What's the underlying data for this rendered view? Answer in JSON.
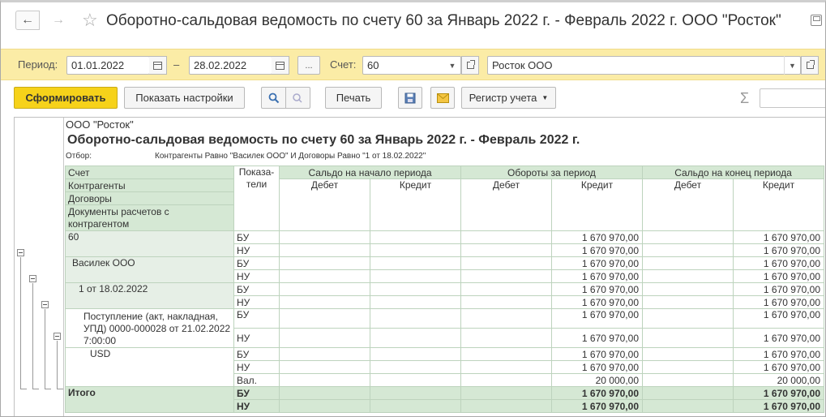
{
  "window": {
    "title": "Оборотно-сальдовая ведомость по счету 60 за Январь 2022 г. - Февраль 2022 г. ООО \"Росток\""
  },
  "filters": {
    "period_label": "Период:",
    "date_from": "01.01.2022",
    "dash": "–",
    "date_to": "28.02.2022",
    "more_label": "...",
    "account_label": "Счет:",
    "account_value": "60",
    "organization_value": "Росток ООО"
  },
  "toolbar": {
    "generate_label": "Сформировать",
    "settings_label": "Показать настройки",
    "print_label": "Печать",
    "register_label": "Регистр учета",
    "sigma": "Σ"
  },
  "report": {
    "org": "ООО \"Росток\"",
    "title": "Оборотно-сальдовая ведомость по счету 60 за Январь 2022 г. - Февраль 2022 г.",
    "filter_label": "Отбор:",
    "filter_text": "Контрагенты Равно \"Василек ООО\" И Договоры Равно \"1 от 18.02.2022\"",
    "headers": {
      "account": "Счет",
      "counterparties": "Контрагенты",
      "contracts": "Договоры",
      "documents": "Документы расчетов с контрагентом",
      "indicators": "Показа-тели",
      "opening": "Сальдо на начало периода",
      "turnover": "Обороты за период",
      "closing": "Сальдо на конец периода",
      "debit": "Дебет",
      "credit": "Кредит"
    },
    "rows": [
      {
        "name": "60",
        "ind": "БУ",
        "turn_credit": "1 670 970,00",
        "close_credit": "1 670 970,00"
      },
      {
        "name": "",
        "ind": "НУ",
        "turn_credit": "1 670 970,00",
        "close_credit": "1 670 970,00"
      },
      {
        "name": "Василек ООО",
        "ind": "БУ",
        "turn_credit": "1 670 970,00",
        "close_credit": "1 670 970,00"
      },
      {
        "name": "",
        "ind": "НУ",
        "turn_credit": "1 670 970,00",
        "close_credit": "1 670 970,00"
      },
      {
        "name": "1 от 18.02.2022",
        "ind": "БУ",
        "turn_credit": "1 670 970,00",
        "close_credit": "1 670 970,00"
      },
      {
        "name": "",
        "ind": "НУ",
        "turn_credit": "1 670 970,00",
        "close_credit": "1 670 970,00"
      },
      {
        "name": "Поступление (акт, накладная, УПД) 0000-000028 от 21.02.2022 7:00:00",
        "ind": "БУ",
        "turn_credit": "1 670 970,00",
        "close_credit": "1 670 970,00"
      },
      {
        "name": "",
        "ind": "НУ",
        "turn_credit": "1 670 970,00",
        "close_credit": "1 670 970,00"
      },
      {
        "name": "USD",
        "ind": "БУ",
        "turn_credit": "1 670 970,00",
        "close_credit": "1 670 970,00"
      },
      {
        "name": "",
        "ind": "НУ",
        "turn_credit": "1 670 970,00",
        "close_credit": "1 670 970,00"
      },
      {
        "name": "",
        "ind": "Вал.",
        "turn_credit": "20 000,00",
        "close_credit": "20 000,00"
      },
      {
        "name": "Итого",
        "ind": "БУ",
        "turn_credit": "1 670 970,00",
        "close_credit": "1 670 970,00"
      },
      {
        "name": "",
        "ind": "НУ",
        "turn_credit": "1 670 970,00",
        "close_credit": "1 670 970,00"
      }
    ]
  },
  "colors": {
    "filter_bg": "#fbeca6",
    "primary_button": "#f6d21a",
    "header_green": "#d5e8d4",
    "group_row_green": "#e6efe6"
  }
}
